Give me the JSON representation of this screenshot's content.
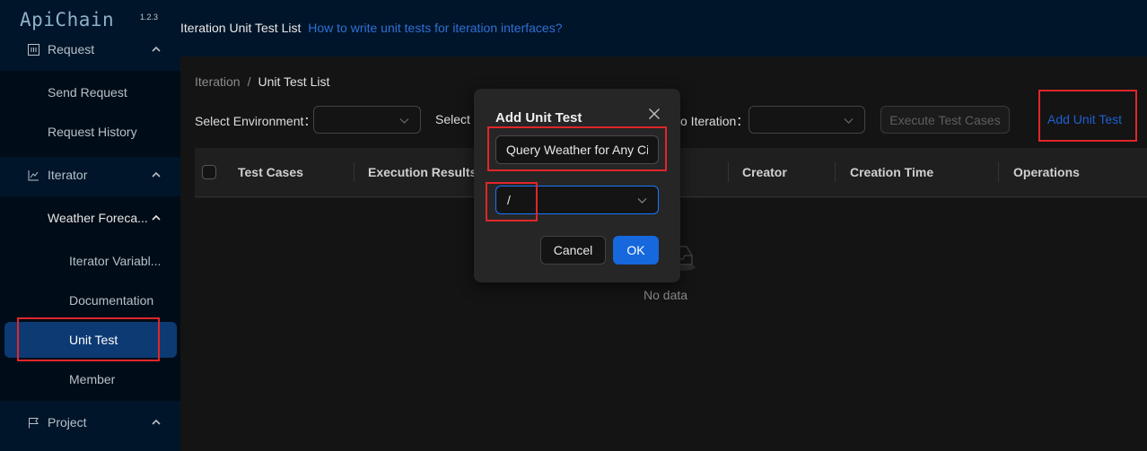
{
  "app": {
    "logo": "ApiChain",
    "version": "1.2.3"
  },
  "sidebar": {
    "items": [
      {
        "label": "Request",
        "icon": "request-icon"
      },
      {
        "label": "Send Request"
      },
      {
        "label": "Request History"
      },
      {
        "label": "Iterator",
        "icon": "chart-icon"
      },
      {
        "label": "Weather Foreca..."
      },
      {
        "label": "Iterator Variabl..."
      },
      {
        "label": "Documentation"
      },
      {
        "label": "Unit Test"
      },
      {
        "label": "Member"
      },
      {
        "label": "Project",
        "icon": "flag-icon"
      }
    ]
  },
  "header": {
    "title": "Iteration Unit Test List",
    "link": "How to write unit tests for iteration interfaces?"
  },
  "breadcrumb": {
    "parent": "Iteration",
    "separator": "/",
    "current": "Unit Test List"
  },
  "filters": {
    "env_label": "Select Environment：",
    "second_label": "Select I",
    "iteration_label": "o Iteration："
  },
  "buttons": {
    "execute": "Execute Test Cases",
    "add": "Add Unit Test"
  },
  "table": {
    "columns": [
      "Test Cases",
      "Execution Results",
      "Creator",
      "Creation Time",
      "Operations"
    ],
    "empty": "No data"
  },
  "modal": {
    "title": "Add Unit Test",
    "input_value": "Query Weather for Any Ci",
    "select_value": "/",
    "cancel": "Cancel",
    "ok": "OK"
  },
  "colors": {
    "accent": "#1668dc",
    "highlight": "#e0262a",
    "sidebar_bg": "#001529"
  }
}
